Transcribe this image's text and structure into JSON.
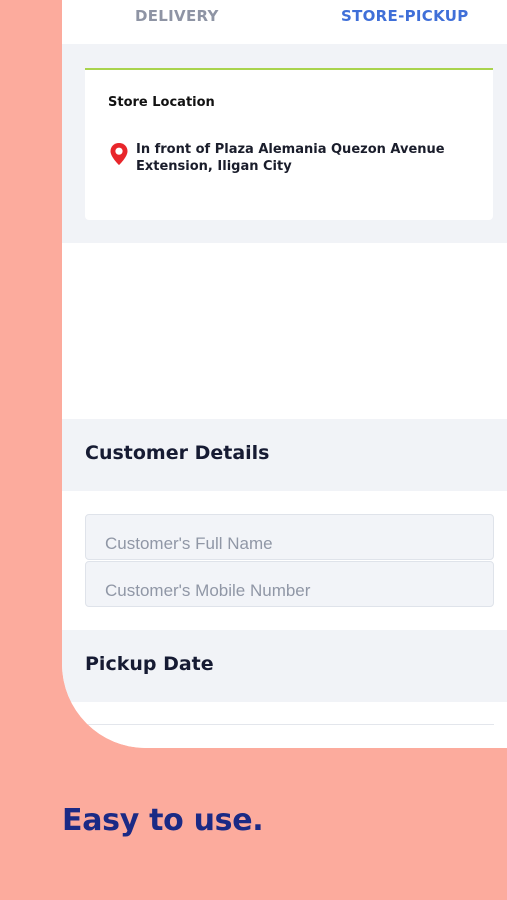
{
  "tabs": {
    "delivery": "DELIVERY",
    "store_pickup": "STORE-PICKUP"
  },
  "store": {
    "title": "Store Location",
    "address": "In front of Plaza Alemania Quezon Avenue Extension, Iligan City",
    "pin_icon": "location-pin-icon"
  },
  "customer_details": {
    "title": "Customer Details",
    "full_name_placeholder": "Customer's Full Name",
    "mobile_placeholder": "Customer's Mobile Number"
  },
  "pickup_date": {
    "title": "Pickup Date"
  },
  "tagline": "Easy to use.",
  "colors": {
    "background": "#fcab9d",
    "active_tab": "#3f6fd8",
    "inactive_tab": "#8e94a4",
    "accent_line": "#a9d34d",
    "pin": "#e8262b",
    "tagline": "#1b2a85"
  }
}
